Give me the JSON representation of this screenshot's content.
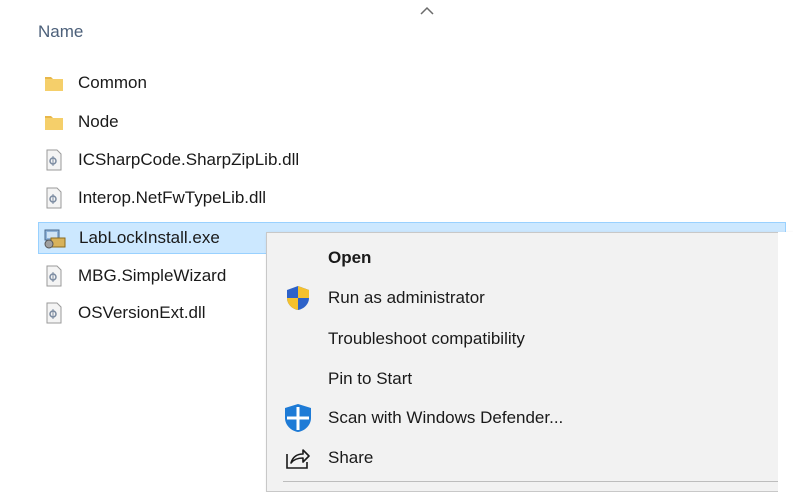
{
  "header": {
    "name_column": "Name"
  },
  "files": [
    {
      "name": "Common",
      "icon": "folder-icon"
    },
    {
      "name": "Node",
      "icon": "folder-icon"
    },
    {
      "name": "ICSharpCode.SharpZipLib.dll",
      "icon": "dll-file-icon"
    },
    {
      "name": "Interop.NetFwTypeLib.dll",
      "icon": "dll-file-icon"
    },
    {
      "name": "LabLockInstall.exe",
      "icon": "installer-exe-icon",
      "selected": true
    },
    {
      "name": "MBG.SimpleWizard",
      "icon": "dll-file-icon"
    },
    {
      "name": "OSVersionExt.dll",
      "icon": "dll-file-icon"
    }
  ],
  "context_menu": {
    "items": [
      {
        "label": "Open",
        "bold": true
      },
      {
        "label": "Run as administrator",
        "icon": "uac-shield-icon"
      },
      {
        "label": "Troubleshoot compatibility"
      },
      {
        "label": "Pin to Start"
      },
      {
        "label": "Scan with Windows Defender...",
        "icon": "windows-defender-icon"
      },
      {
        "label": "Share",
        "icon": "share-icon"
      }
    ]
  },
  "colors": {
    "selection_bg": "#cce8ff",
    "selection_border": "#99d1ff",
    "header_text": "#4c607a",
    "menu_bg": "#f2f2f2",
    "folder": "#e8b74a",
    "defender_blue": "#1e7bd6"
  }
}
